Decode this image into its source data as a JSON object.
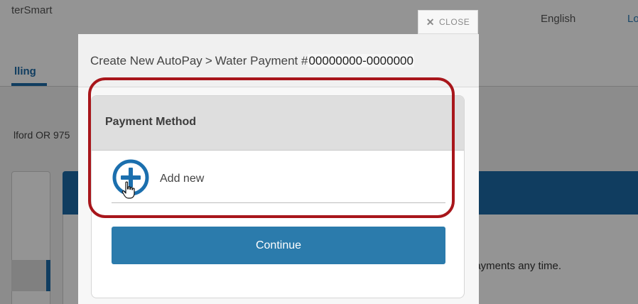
{
  "background": {
    "brand_fragment": "terSmart",
    "language": "English",
    "login_fragment": "Lo",
    "tab_fragment": "lling",
    "address_fragment": "lford OR 975",
    "autopay_text_fragment": "payments any time."
  },
  "modal": {
    "close_label": "CLOSE",
    "close_icon": "close-x-icon",
    "breadcrumb_create": "Create New AutoPay",
    "breadcrumb_separator": ">",
    "breadcrumb_account_label": "Water Payment #",
    "account_number": "00000000-0000000"
  },
  "payment_method": {
    "title": "Payment Method",
    "add_new_label": "Add new",
    "add_icon": "plus-circle-icon",
    "cursor_icon": "hand-pointer-icon"
  },
  "actions": {
    "continue_label": "Continue"
  },
  "colors": {
    "accent_blue": "#2b7bac",
    "highlight_red": "#a8161b",
    "icon_blue": "#1b6fae"
  }
}
